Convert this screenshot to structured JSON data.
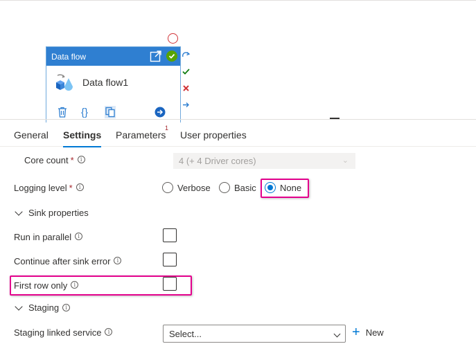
{
  "node": {
    "header_title": "Data flow",
    "activity_name": "Data flow1",
    "tool_braces": "{}"
  },
  "tabs": [
    {
      "label": "General"
    },
    {
      "label": "Settings"
    },
    {
      "label": "Parameters",
      "badge": "1"
    },
    {
      "label": "User properties"
    }
  ],
  "settings": {
    "core_count_label": "Core count",
    "core_count_value": "4 (+ 4 Driver cores)",
    "logging_level_label": "Logging level",
    "required_mark": "*",
    "info_glyph": "i",
    "logging_options": [
      "Verbose",
      "Basic",
      "None"
    ],
    "logging_selected": "None",
    "sink_section": "Sink properties",
    "run_in_parallel_label": "Run in parallel",
    "continue_after_error_label": "Continue after sink error",
    "first_row_only_label": "First row only",
    "staging_section": "Staging",
    "staging_linked_service_label": "Staging linked service",
    "staging_placeholder": "Select...",
    "new_button": "New"
  },
  "colors": {
    "accent": "#0078d4",
    "node_header": "#2f7fd1",
    "success": "#57a300",
    "error": "#d13438",
    "highlight": "#e3008c"
  }
}
